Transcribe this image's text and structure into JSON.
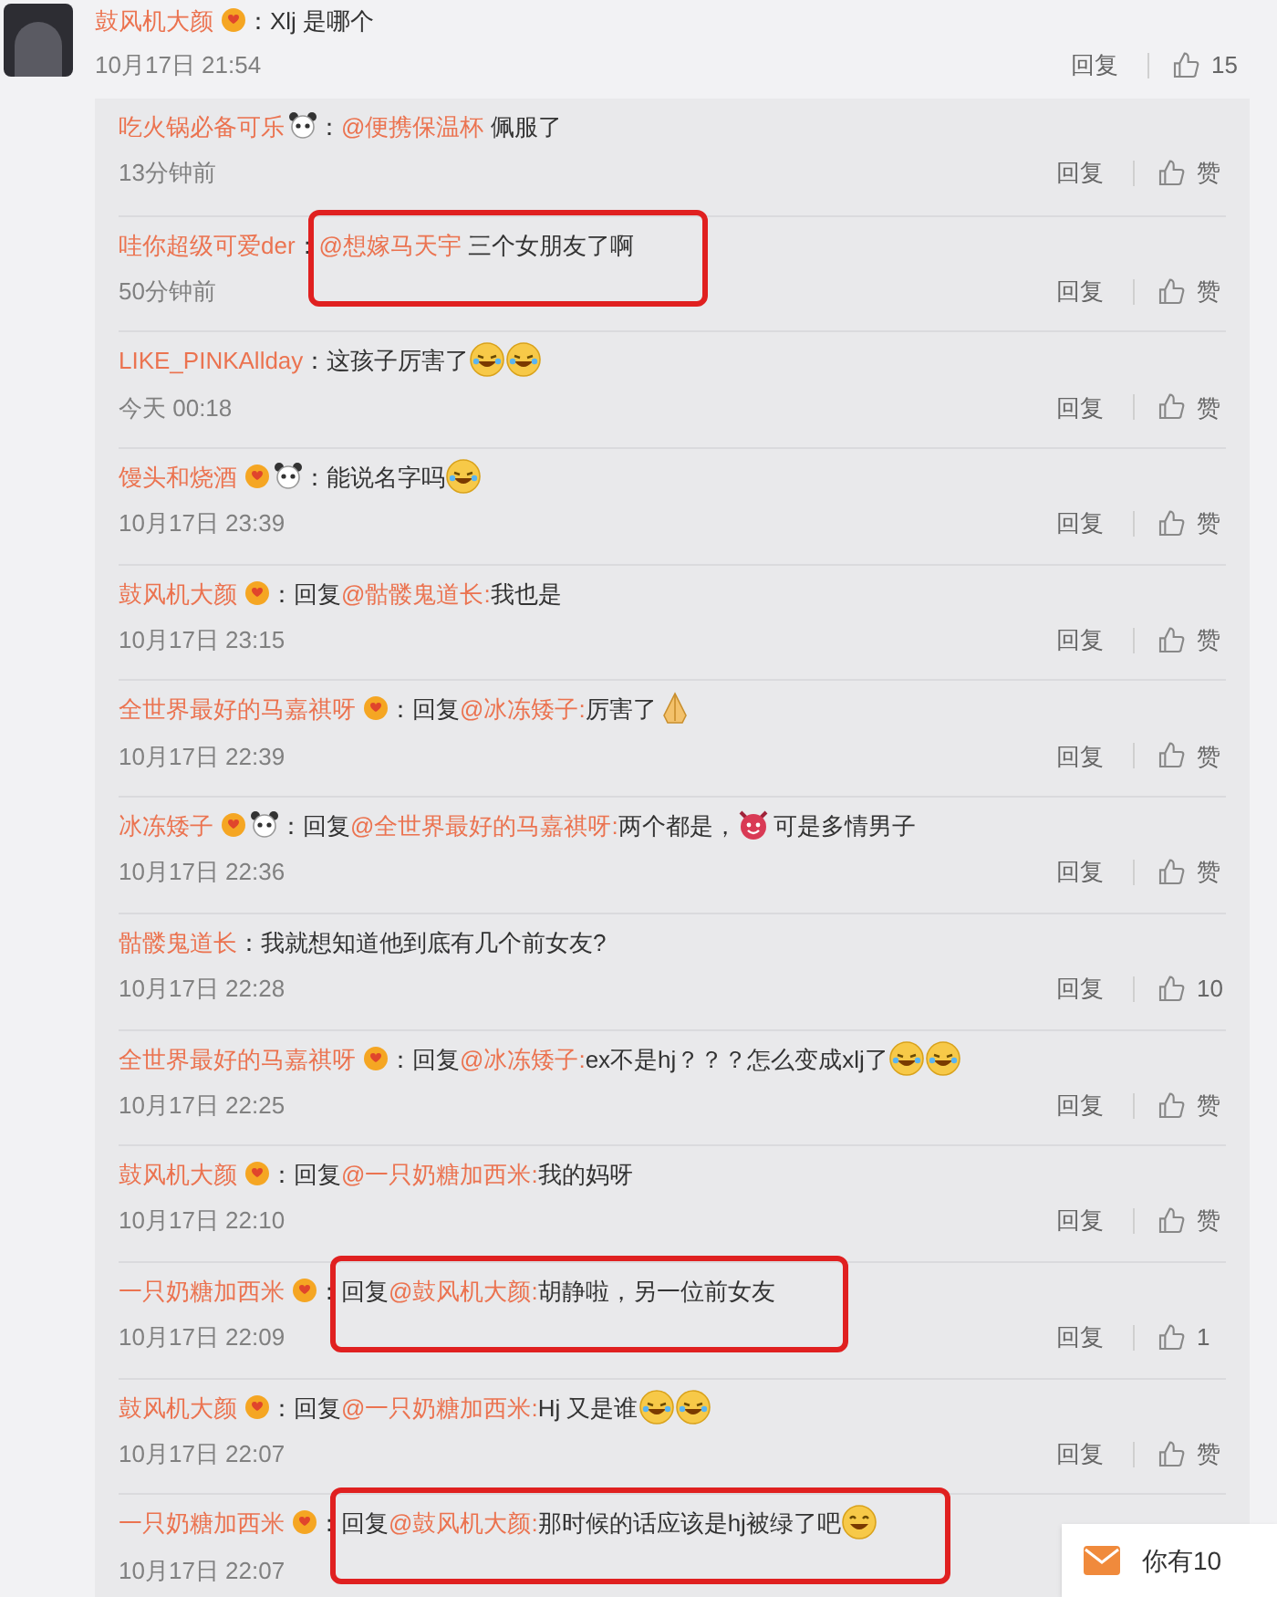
{
  "comment": {
    "user": "鼓风机大颜",
    "badges": [
      {
        "kind": "heart"
      }
    ],
    "sep": "：",
    "content": [
      {
        "kind": "text",
        "text": "Xlj 是哪个"
      }
    ],
    "highlighted": false,
    "time": "10月17日 21:54",
    "reply": "回复",
    "like": "15"
  },
  "replies": [
    {
      "user": "吃火锅必备可乐",
      "badges": [
        {
          "kind": "panda"
        }
      ],
      "sep": "：",
      "content": [
        {
          "kind": "mention",
          "text": "@便携保温杯"
        },
        {
          "kind": "text",
          "text": " 佩服了"
        }
      ],
      "highlighted": false,
      "time": "13分钟前",
      "reply": "回复",
      "like": "赞"
    },
    {
      "user": "哇你超级可爱der",
      "sep": "：",
      "content": [
        {
          "kind": "mention",
          "text": "@想嫁马天宇"
        },
        {
          "kind": "text",
          "text": " 三个女朋友了啊"
        }
      ],
      "highlighted": true,
      "time": "50分钟前",
      "reply": "回复",
      "like": "赞"
    },
    {
      "user": "LIKE_PINKAllday",
      "sep": "：",
      "content": [
        {
          "kind": "text",
          "text": "这孩子厉害了"
        },
        {
          "kind": "laugh"
        },
        {
          "kind": "laugh"
        }
      ],
      "highlighted": false,
      "time": "今天 00:18",
      "reply": "回复",
      "like": "赞"
    },
    {
      "user": "馒头和烧酒",
      "badges": [
        {
          "kind": "heart"
        },
        {
          "kind": "panda"
        }
      ],
      "sep": "：",
      "content": [
        {
          "kind": "text",
          "text": "能说名字吗"
        },
        {
          "kind": "laugh"
        }
      ],
      "highlighted": false,
      "time": "10月17日 23:39",
      "reply": "回复",
      "like": "赞"
    },
    {
      "user": "鼓风机大颜",
      "badges": [
        {
          "kind": "heart"
        }
      ],
      "sep": "：",
      "content": [
        {
          "kind": "text",
          "text": "回复"
        },
        {
          "kind": "mention",
          "text": "@骷髅鬼道长:"
        },
        {
          "kind": "text",
          "text": "我也是"
        }
      ],
      "highlighted": false,
      "time": "10月17日 23:15",
      "reply": "回复",
      "like": "赞"
    },
    {
      "user": "全世界最好的马嘉祺呀",
      "badges": [
        {
          "kind": "heart"
        }
      ],
      "sep": "：",
      "content": [
        {
          "kind": "text",
          "text": "回复"
        },
        {
          "kind": "mention",
          "text": "@冰冻矮子:"
        },
        {
          "kind": "text",
          "text": "厉害了"
        },
        {
          "kind": "pray"
        }
      ],
      "highlighted": false,
      "time": "10月17日 22:39",
      "reply": "回复",
      "like": "赞"
    },
    {
      "user": "冰冻矮子",
      "badges": [
        {
          "kind": "heart"
        },
        {
          "kind": "panda"
        }
      ],
      "sep": "：",
      "content": [
        {
          "kind": "text",
          "text": "回复"
        },
        {
          "kind": "mention",
          "text": "@全世界最好的马嘉祺呀:"
        },
        {
          "kind": "text",
          "text": "两个都是，"
        },
        {
          "kind": "devil"
        },
        {
          "kind": "text",
          "text": "可是多情男子"
        }
      ],
      "highlighted": false,
      "time": "10月17日 22:36",
      "reply": "回复",
      "like": "赞"
    },
    {
      "user": "骷髅鬼道长",
      "sep": "：",
      "content": [
        {
          "kind": "text",
          "text": "我就想知道他到底有几个前女友?"
        }
      ],
      "highlighted": false,
      "time": "10月17日 22:28",
      "reply": "回复",
      "like": "10"
    },
    {
      "user": "全世界最好的马嘉祺呀",
      "badges": [
        {
          "kind": "heart"
        }
      ],
      "sep": "：",
      "content": [
        {
          "kind": "text",
          "text": "回复"
        },
        {
          "kind": "mention",
          "text": "@冰冻矮子:"
        },
        {
          "kind": "text",
          "text": "ex不是hj？？？怎么变成xlj了"
        },
        {
          "kind": "laugh"
        },
        {
          "kind": "laugh"
        }
      ],
      "highlighted": false,
      "time": "10月17日 22:25",
      "reply": "回复",
      "like": "赞"
    },
    {
      "user": "鼓风机大颜",
      "badges": [
        {
          "kind": "heart"
        }
      ],
      "sep": "：",
      "content": [
        {
          "kind": "text",
          "text": "回复"
        },
        {
          "kind": "mention",
          "text": "@一只奶糖加西米:"
        },
        {
          "kind": "text",
          "text": "我的妈呀"
        }
      ],
      "highlighted": false,
      "time": "10月17日 22:10",
      "reply": "回复",
      "like": "赞"
    },
    {
      "user": "一只奶糖加西米",
      "badges": [
        {
          "kind": "heart"
        }
      ],
      "sep": "：",
      "content": [
        {
          "kind": "text",
          "text": "回复"
        },
        {
          "kind": "mention",
          "text": "@鼓风机大颜:"
        },
        {
          "kind": "text",
          "text": "胡静啦，另一位前女友"
        }
      ],
      "highlighted": true,
      "time": "10月17日 22:09",
      "reply": "回复",
      "like": "1"
    },
    {
      "user": "鼓风机大颜",
      "badges": [
        {
          "kind": "heart"
        }
      ],
      "sep": "：",
      "content": [
        {
          "kind": "text",
          "text": "回复"
        },
        {
          "kind": "mention",
          "text": "@一只奶糖加西米:"
        },
        {
          "kind": "text",
          "text": "Hj 又是谁"
        },
        {
          "kind": "laugh"
        },
        {
          "kind": "laugh"
        }
      ],
      "highlighted": false,
      "time": "10月17日 22:07",
      "reply": "回复",
      "like": "赞"
    },
    {
      "user": "一只奶糖加西米",
      "badges": [
        {
          "kind": "heart"
        }
      ],
      "sep": "：",
      "content": [
        {
          "kind": "text",
          "text": "回复"
        },
        {
          "kind": "mention",
          "text": "@鼓风机大颜:"
        },
        {
          "kind": "text",
          "text": "那时候的话应该是hj被绿了吧"
        },
        {
          "kind": "grin"
        }
      ],
      "highlighted": true,
      "time": "10月17日 22:07"
    }
  ],
  "notification": {
    "text": "你有10"
  }
}
